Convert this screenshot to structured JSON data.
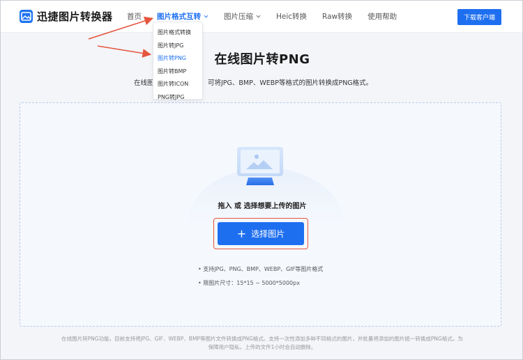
{
  "header": {
    "logo_text": "迅捷图片转换器",
    "nav": [
      {
        "label": "首页",
        "active": false,
        "dropdown": false
      },
      {
        "label": "图片格式互转",
        "active": true,
        "dropdown": true
      },
      {
        "label": "图片压缩",
        "active": false,
        "dropdown": true
      },
      {
        "label": "Heic转换",
        "active": false,
        "dropdown": false
      },
      {
        "label": "Raw转换",
        "active": false,
        "dropdown": false
      },
      {
        "label": "使用帮助",
        "active": false,
        "dropdown": false
      }
    ],
    "download_label": "下载客户端"
  },
  "dropdown": {
    "items": [
      "图片格式转换",
      "图片转JPG",
      "图片转PNG",
      "图片转BMP",
      "图片转ICON",
      "PNG转JPG"
    ],
    "active_index": 2
  },
  "main": {
    "title": "在线图片转PNG",
    "subtitle_left": "在线图",
    "subtitle_right": "可将JPG、BMP、WEBP等格式的图片转换成PNG格式。"
  },
  "upload": {
    "drop_text": "拖入 或 选择想要上传的图片",
    "select_label": "选择图片",
    "hints": [
      "• 支持JPG、PNG、BMP、WEBP、GIF等图片格式",
      "• 限图片尺寸：15*15 ~ 5000*5000px"
    ]
  },
  "footer": {
    "line1": "在线图片转PNG功能，目前支持将JPG、GIF、WEBP、BMP等图片文件转换成PNG格式。支持一次性添加多种不同格式的图片，并批量将添加的图片统一转换成PNG格式。为",
    "line2": "保障用户隐私，上传的文件1小时会自动删除。"
  },
  "colors": {
    "brand": "#1e6ff0",
    "annotation": "#e6553f"
  }
}
